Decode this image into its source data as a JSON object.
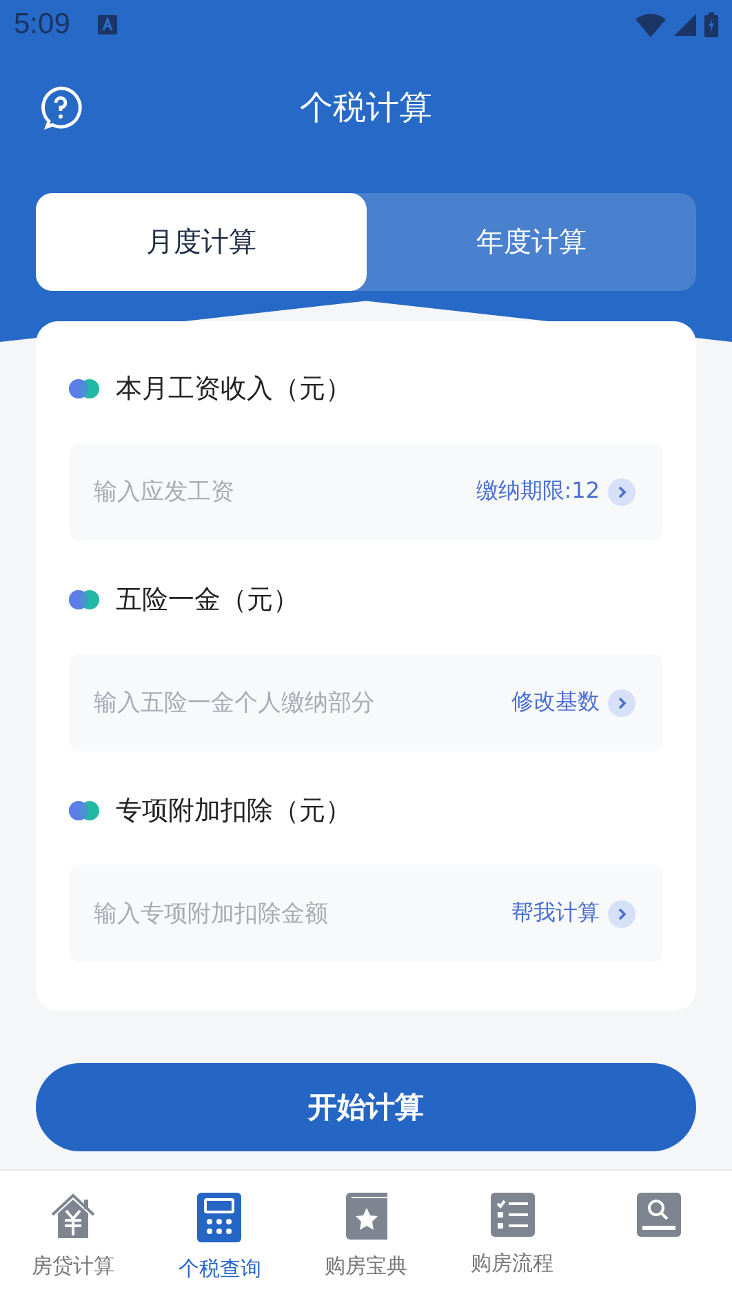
{
  "status_bar": {
    "time": "5:09"
  },
  "header": {
    "title": "个税计算"
  },
  "tabs": [
    {
      "label": "月度计算",
      "selected": true
    },
    {
      "label": "年度计算",
      "selected": false
    }
  ],
  "fields": [
    {
      "label": "本月工资收入（元）",
      "placeholder": "输入应发工资",
      "action": "缴纳期限:12"
    },
    {
      "label": "五险一金（元）",
      "placeholder": "输入五险一金个人缴纳部分",
      "action": "修改基数"
    },
    {
      "label": "专项附加扣除（元）",
      "placeholder": "输入专项附加扣除金额",
      "action": "帮我计算"
    }
  ],
  "submit_button": "开始计算",
  "nav": [
    {
      "label": "房贷计算",
      "kind": "house",
      "selected": false
    },
    {
      "label": "个税查询",
      "kind": "calculator",
      "selected": true
    },
    {
      "label": "购房宝典",
      "kind": "book",
      "selected": false
    },
    {
      "label": "购房流程",
      "kind": "list",
      "selected": false
    },
    {
      "kind": "search",
      "selected": false
    }
  ]
}
